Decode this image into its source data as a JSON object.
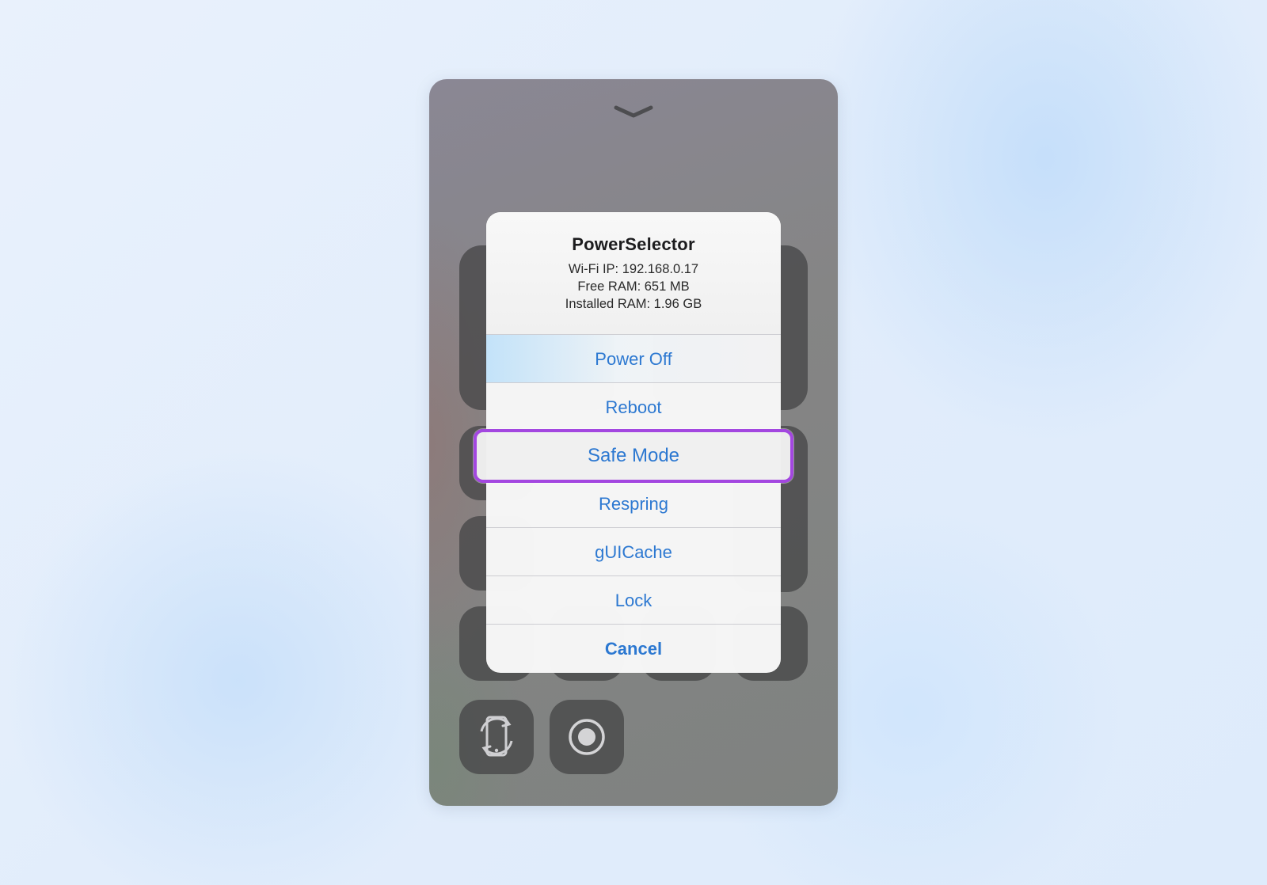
{
  "alert": {
    "title": "PowerSelector",
    "info": [
      "Wi-Fi IP: 192.168.0.17",
      "Free RAM: 651 MB",
      "Installed RAM: 1.96 GB"
    ],
    "actions": [
      {
        "label": "Power Off"
      },
      {
        "label": "Reboot"
      },
      {
        "label": "Safe Mode",
        "highlighted": true
      },
      {
        "label": "Respring"
      },
      {
        "label": "gUICache"
      },
      {
        "label": "Lock"
      },
      {
        "label": "Cancel",
        "bold": true
      }
    ]
  },
  "icons": {
    "grabber": "chevron-down-icon",
    "tile_1": "rotation-lock-icon",
    "tile_2": "screen-record-icon"
  },
  "colors": {
    "action_text": "#2c78d1",
    "highlight_border": "#a347e0",
    "panel": "#858585",
    "tile": "#464648"
  }
}
